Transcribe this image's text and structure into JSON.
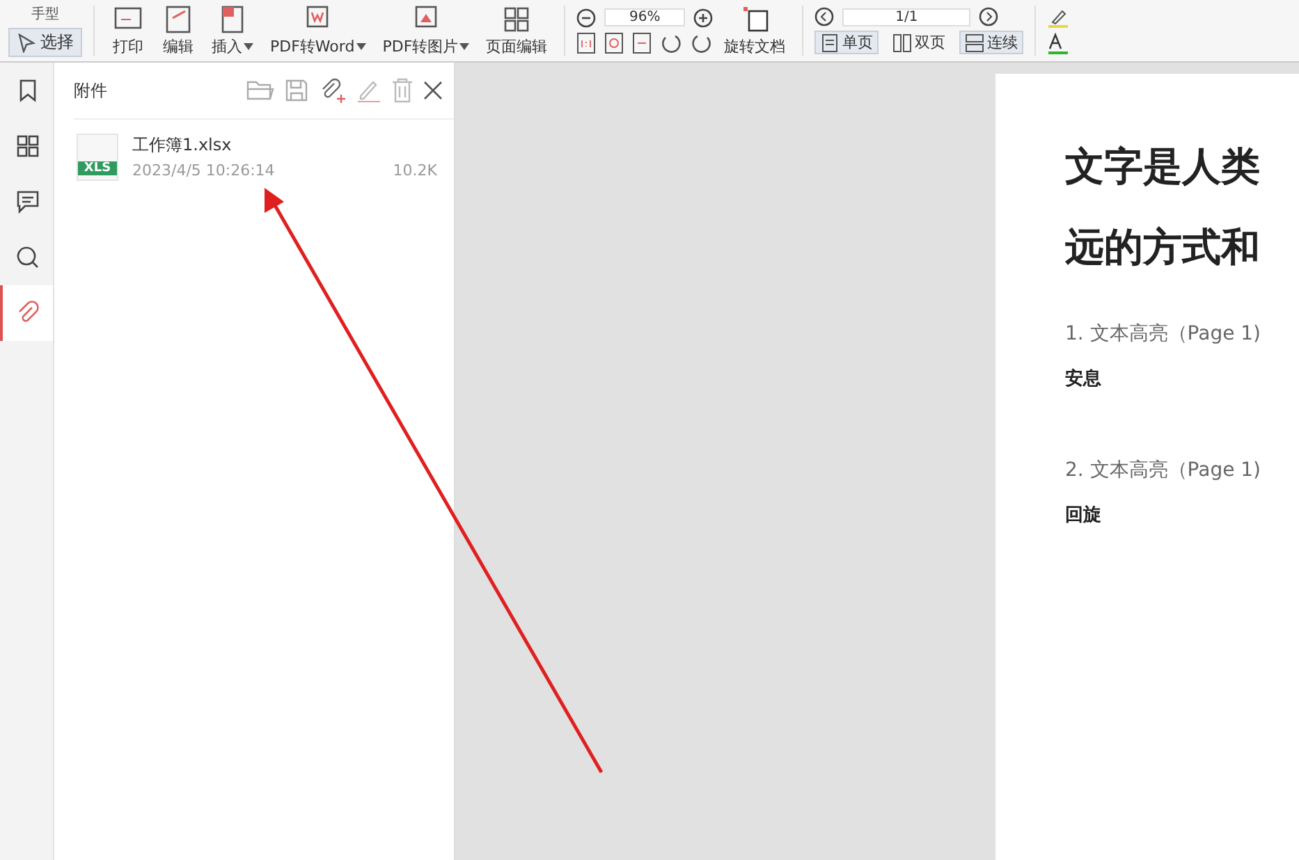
{
  "toolbar": {
    "hand_tool": {
      "label": "手型"
    },
    "select_tool": {
      "label": "选择",
      "selected": true
    },
    "buttons": [
      {
        "label": "打印",
        "kind": "print",
        "dropdown": false
      },
      {
        "label": "编辑",
        "kind": "edit",
        "dropdown": false
      },
      {
        "label": "插入",
        "kind": "insert",
        "dropdown": true
      },
      {
        "label": "PDF转Word",
        "kind": "word",
        "dropdown": true
      },
      {
        "label": "PDF转图片",
        "kind": "image",
        "dropdown": true
      },
      {
        "label": "页面编辑",
        "kind": "pages",
        "dropdown": false
      }
    ],
    "zoom": {
      "value": "96%"
    },
    "rotate": {
      "label": "旋转文档"
    },
    "page": {
      "value": "1/1"
    },
    "view_modes": [
      {
        "label": "单页",
        "kind": "single",
        "selected": true
      },
      {
        "label": "双页",
        "kind": "double",
        "selected": false
      },
      {
        "label": "连续",
        "kind": "continuous",
        "selected": true
      }
    ]
  },
  "sidebar": {
    "items": [
      {
        "kind": "bookmark",
        "selected": false
      },
      {
        "kind": "thumbnails",
        "selected": false
      },
      {
        "kind": "comment",
        "selected": false
      },
      {
        "kind": "search",
        "selected": false
      },
      {
        "kind": "attachment",
        "selected": true
      }
    ]
  },
  "attachments_panel": {
    "title": "附件",
    "files": [
      {
        "name": "工作簿1.xlsx",
        "type": "XLS",
        "date": "2023/4/5 10:26:14",
        "size": "10.2K"
      }
    ]
  },
  "document": {
    "heading_lines": [
      "文字是人类",
      "远的方式和"
    ],
    "annotations": [
      {
        "title": "1. 文本高亮（Page 1)",
        "text": "安息"
      },
      {
        "title": "2. 文本高亮（Page 1)",
        "text": "回旋"
      }
    ]
  }
}
